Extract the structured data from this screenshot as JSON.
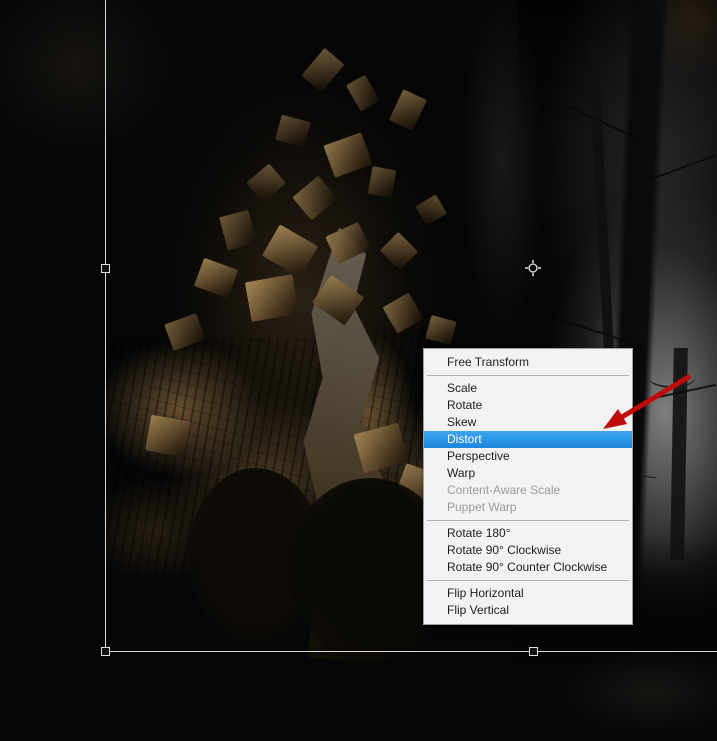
{
  "scene": {
    "description": "Photoshop Free Transform context menu opened over a dark forest photo-manipulation canvas with an active transform bounding box",
    "highlighted_menu_item": "Distort"
  },
  "context_menu": {
    "items": [
      {
        "label": "Free Transform",
        "state": "enabled"
      },
      {
        "label": "Scale",
        "state": "enabled"
      },
      {
        "label": "Rotate",
        "state": "enabled"
      },
      {
        "label": "Skew",
        "state": "enabled"
      },
      {
        "label": "Distort",
        "state": "highlighted"
      },
      {
        "label": "Perspective",
        "state": "enabled"
      },
      {
        "label": "Warp",
        "state": "enabled"
      },
      {
        "label": "Content-Aware Scale",
        "state": "disabled"
      },
      {
        "label": "Puppet Warp",
        "state": "disabled"
      },
      {
        "label": "Rotate 180°",
        "state": "enabled"
      },
      {
        "label": "Rotate 90° Clockwise",
        "state": "enabled"
      },
      {
        "label": "Rotate 90° Counter Clockwise",
        "state": "enabled"
      },
      {
        "label": "Flip Horizontal",
        "state": "enabled"
      },
      {
        "label": "Flip Vertical",
        "state": "enabled"
      }
    ]
  },
  "selection": {
    "handles_visible": [
      "left-middle",
      "bottom-left",
      "bottom-center"
    ],
    "reference_point": "center crosshair"
  },
  "icons": {
    "reference_point": "crosshair-circle-icon",
    "annotation_arrow": "red-callout-arrow"
  },
  "colors": {
    "menu_background": "#f2f2f2",
    "menu_border": "#9e9e9e",
    "menu_text": "#1e1e1e",
    "menu_disabled_text": "#9b9b9b",
    "highlight_blue": "#2b97e9",
    "highlight_text": "#ffffff",
    "annotation_arrow_red": "#c00b0b",
    "selection_outline": "#d9d9d9"
  }
}
